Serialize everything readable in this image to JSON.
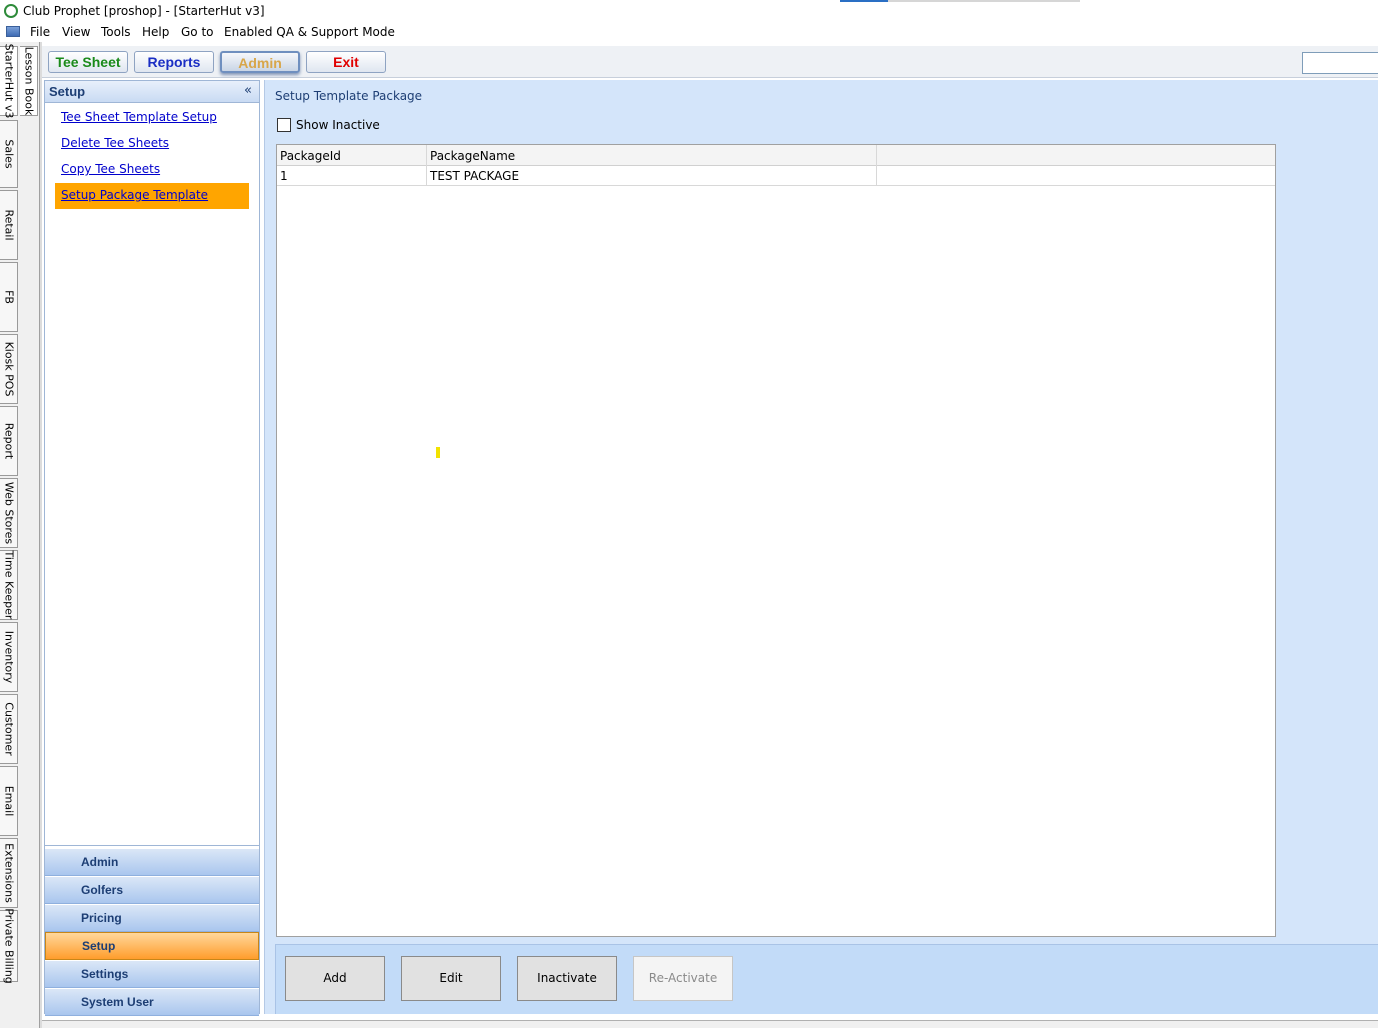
{
  "window": {
    "title": "Club Prophet [proshop] - [StarterHut v3]"
  },
  "menu": [
    "File",
    "View",
    "Tools",
    "Help",
    "Go to",
    "Enabled QA & Support Mode"
  ],
  "vtabs_col1": [
    "StarterHut v3",
    "Sales",
    "Retail",
    "FB",
    "Kiosk POS",
    "Report",
    "Web Stores",
    "Time Keeper",
    "Inventory",
    "Customer",
    "Email",
    "Extensions",
    "Private Billing"
  ],
  "vtabs_col2": [
    "Lesson Book"
  ],
  "toolbar": {
    "tee_sheet": "Tee Sheet",
    "reports": "Reports",
    "admin": "Admin",
    "exit": "Exit",
    "colors": {
      "tee_sheet": "#1a8a1a",
      "reports": "#1a2ec4",
      "exit": "#e00000"
    }
  },
  "sidebar": {
    "title": "Setup",
    "collapse": "«",
    "links": [
      "Tee Sheet Template Setup",
      "Delete Tee Sheets",
      "Copy Tee Sheets",
      "Setup Package Template"
    ],
    "active_link": 3,
    "groups": [
      "Admin",
      "Golfers",
      "Pricing",
      "Setup",
      "Settings",
      "System User"
    ],
    "active_group": 3
  },
  "main": {
    "title": "Setup Template Package",
    "show_inactive": {
      "label": "Show Inactive",
      "checked": false
    },
    "grid": {
      "columns": [
        "PackageId",
        "PackageName"
      ],
      "rows": [
        [
          "1",
          "TEST PACKAGE"
        ]
      ]
    },
    "actions": {
      "add": "Add",
      "edit": "Edit",
      "inactivate": "Inactivate",
      "reactivate": "Re-Activate"
    }
  }
}
